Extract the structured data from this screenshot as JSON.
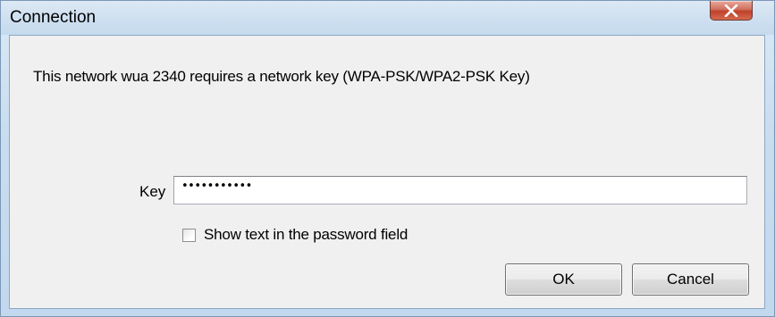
{
  "window": {
    "title": "Connection",
    "close_symbol": "X"
  },
  "dialog": {
    "message": "This network wua 2340 requires a network key (WPA-PSK/WPA2-PSK Key)",
    "key_label": "Key",
    "key_value": "•••••••••••",
    "show_text_label": "Show text in the password field",
    "show_text_checked": false
  },
  "buttons": {
    "ok_label": "OK",
    "cancel_label": "Cancel"
  },
  "icons": {
    "close": "close-icon"
  },
  "colors": {
    "close_button": "#c0412b",
    "client_background": "#f0f0f0",
    "frame": "#c9ddef"
  }
}
